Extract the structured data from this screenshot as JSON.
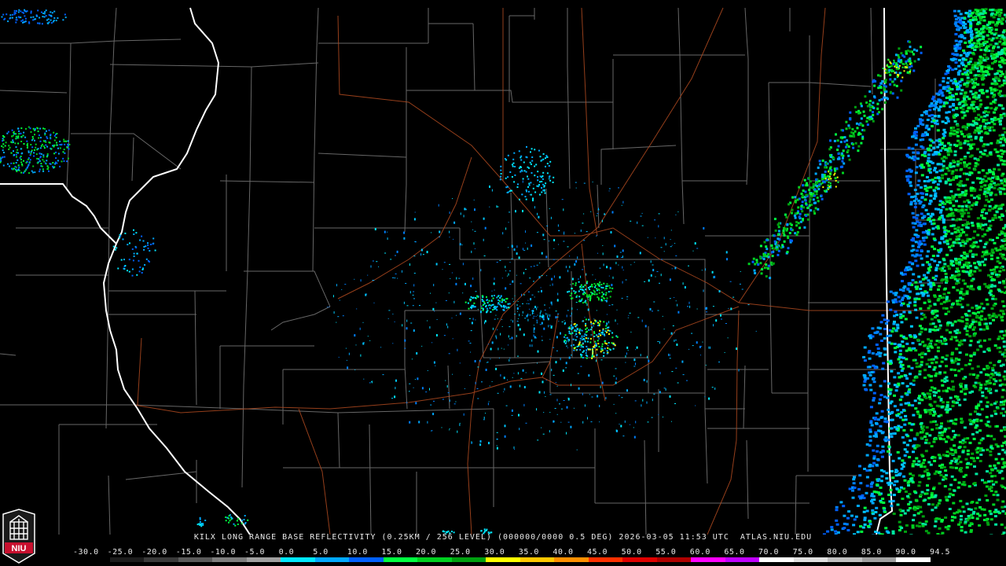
{
  "product": {
    "caption": "KILX LONG RANGE BASE REFLECTIVITY (0.25KM / 256 LEVEL) (000000/0000 0.5 DEG) 2026-03-05 11:53 UTC  ATLAS.NIU.EDU"
  },
  "logo": {
    "text": "NIU",
    "color": "#c8102e"
  },
  "scale": {
    "labels": [
      "-30.0",
      "-25.0",
      "-20.0",
      "-15.0",
      "-10.0",
      "-5.0",
      "0.0",
      "5.0",
      "10.0",
      "15.0",
      "20.0",
      "25.0",
      "30.0",
      "35.0",
      "40.0",
      "45.0",
      "50.0",
      "55.0",
      "60.0",
      "65.0",
      "70.0",
      "75.0",
      "80.0",
      "85.0",
      "90.0",
      "94.5"
    ],
    "colors": [
      "#000000",
      "#1c1c1c",
      "#3a3a3a",
      "#5a5a5a",
      "#7e7e7e",
      "#a0a0a0",
      "#00e8ff",
      "#00a8ff",
      "#0060ff",
      "#00ff40",
      "#00d020",
      "#00a010",
      "#ffff00",
      "#ffc800",
      "#ff9000",
      "#ff3000",
      "#e00000",
      "#b00000",
      "#ff00ff",
      "#c000ff",
      "#ffffff",
      "#e0e0e0",
      "#c0c0c0",
      "#a0a0a0",
      "#ffffff"
    ]
  },
  "map": {
    "background": "#000000",
    "state_border_color": "#ffffff",
    "county_line_color": "#8a8a8a",
    "highway_color": "#b04a20",
    "radar_site": "KILX"
  }
}
